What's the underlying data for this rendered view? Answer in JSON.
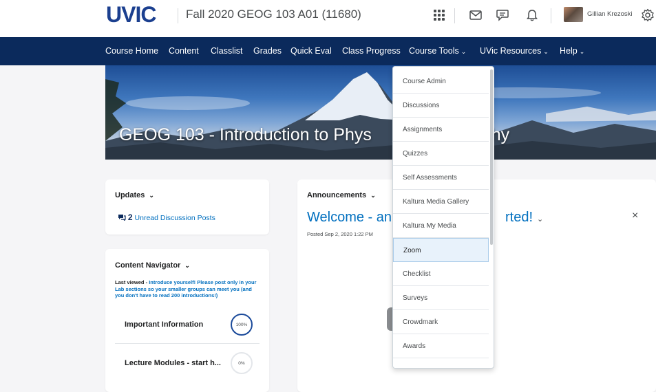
{
  "header": {
    "logo": "UVIC",
    "course_title": "Fall 2020 GEOG 103 A01 (11680)",
    "user_name": "Gillian Krezoski",
    "icons": [
      "grid-icon",
      "mail-icon",
      "chat-icon",
      "bell-icon",
      "gear-icon"
    ]
  },
  "nav": {
    "items": [
      {
        "label": "Course Home"
      },
      {
        "label": "Content"
      },
      {
        "label": "Classlist"
      },
      {
        "label": "Grades"
      },
      {
        "label": "Quick Eval"
      },
      {
        "label": "Class Progress"
      },
      {
        "label": "Course Tools"
      },
      {
        "label": "UVic Resources"
      },
      {
        "label": "Help"
      }
    ],
    "chevron": "⌄"
  },
  "banner": {
    "title": "GEOG 103 - Introduction to Phys",
    "title_tail": "phy"
  },
  "updates": {
    "heading": "Updates",
    "count": "2",
    "link_text": "Unread Discussion Posts"
  },
  "content_navigator": {
    "heading": "Content Navigator",
    "last_viewed_label": "Last viewed - ",
    "last_viewed_link": "Introduce yourself! Please post only in your Lab sections so your smaller groups can meet you (and you don't have to read 200 introductions!)",
    "modules": [
      {
        "name": "Important Information",
        "progress_label": "100%",
        "progress": 1.0
      },
      {
        "name": "Lecture Modules - start h...",
        "progress_label": "0%",
        "progress": 0.0
      }
    ]
  },
  "announcements": {
    "heading": "Announcements",
    "title_start": "Welcome - an",
    "title_end": "rted!",
    "posted": "Posted Sep 2, 2020 1:22 PM",
    "close": "×"
  },
  "course_tools_menu": {
    "items": [
      {
        "label": "Course Admin"
      },
      {
        "label": "Discussions"
      },
      {
        "label": "Assignments"
      },
      {
        "label": "Quizzes"
      },
      {
        "label": "Self Assessments"
      },
      {
        "label": "Kaltura Media Gallery"
      },
      {
        "label": "Kaltura My Media"
      },
      {
        "label": "Zoom"
      },
      {
        "label": "Checklist"
      },
      {
        "label": "Surveys"
      },
      {
        "label": "Crowdmark"
      },
      {
        "label": "Awards"
      }
    ],
    "active_index": 7
  },
  "colors": {
    "nav_bg": "#0b2a5c",
    "link": "#006fbf",
    "logo": "#1b3f8f",
    "progress_ring": "#1b4a9a"
  }
}
